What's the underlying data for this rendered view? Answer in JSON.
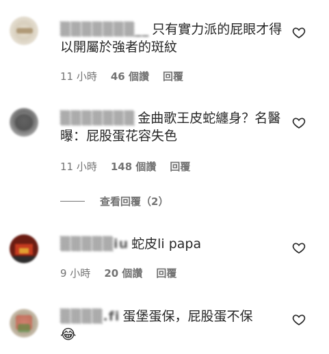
{
  "comments": [
    {
      "username": "▒▒▒▒▒▒▒__",
      "text": "只有實力派的屁眼才得以開屬於強者的斑紋",
      "time": "11 小時",
      "likes": "46 個讚",
      "reply": "回覆"
    },
    {
      "username": "▒▒▒▒▒▒▒",
      "text": "金曲歌王皮蛇纏身？名醫曝：屁股蛋花容失色",
      "time": "11 小時",
      "likes": "148 個讚",
      "reply": "回覆"
    },
    {
      "username": "▒▒▒▒▒iu",
      "text": "蛇皮li papa",
      "time": "9 小時",
      "likes": "20 個讚",
      "reply": "回覆"
    },
    {
      "username": "▒▒▒▒.fi",
      "text": "蛋堡蛋保，屁股蛋不保",
      "emoji": "😂"
    }
  ],
  "view_replies": "查看回覆（2）"
}
